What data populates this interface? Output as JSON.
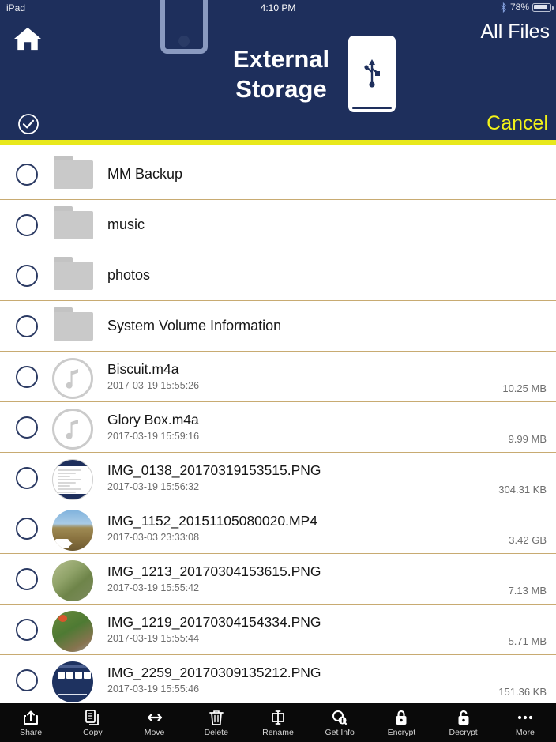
{
  "statusbar": {
    "device": "iPad",
    "time": "4:10 PM",
    "battery_percent": "78%",
    "bluetooth_icon": "bluetooth-icon",
    "battery_icon": "battery-icon"
  },
  "header": {
    "home_icon": "home-icon",
    "title_line1": "External",
    "title_line2": "Storage",
    "all_files_label": "All Files",
    "usb_icon": "usb-icon",
    "device_icon": "ipad-device-icon",
    "select_all_icon": "check-circle-icon",
    "cancel_label": "Cancel",
    "navy": "#1e2f5c",
    "yellow": "#e8e81c",
    "cancel_color": "#f2f218"
  },
  "files": [
    {
      "name": "MM Backup",
      "date": "",
      "size": "",
      "kind": "folder"
    },
    {
      "name": "music",
      "date": "",
      "size": "",
      "kind": "folder"
    },
    {
      "name": "photos",
      "date": "",
      "size": "",
      "kind": "folder"
    },
    {
      "name": "System Volume Information",
      "date": "",
      "size": "",
      "kind": "folder"
    },
    {
      "name": "Biscuit.m4a",
      "date": "2017-03-19 15:55:26",
      "size": "10.25 MB",
      "kind": "audio"
    },
    {
      "name": "Glory Box.m4a",
      "date": "2017-03-19 15:59:16",
      "size": "9.99 MB",
      "kind": "audio"
    },
    {
      "name": "IMG_0138_20170319153515.PNG",
      "date": "2017-03-19 15:56:32",
      "size": "304.31 KB",
      "kind": "photo-doc"
    },
    {
      "name": "IMG_1152_20151105080020.MP4",
      "date": "2017-03-03 23:33:08",
      "size": "3.42 GB",
      "kind": "video"
    },
    {
      "name": "IMG_1213_20170304153615.PNG",
      "date": "2017-03-19 15:55:42",
      "size": "7.13 MB",
      "kind": "photo-grass"
    },
    {
      "name": "IMG_1219_20170304154334.PNG",
      "date": "2017-03-19 15:55:44",
      "size": "5.71 MB",
      "kind": "photo-tomato"
    },
    {
      "name": "IMG_2259_20170309135212.PNG",
      "date": "2017-03-19 15:55:46",
      "size": "151.36 KB",
      "kind": "photo-screen"
    }
  ],
  "toolbar": [
    {
      "label": "Share",
      "icon": "share-icon"
    },
    {
      "label": "Copy",
      "icon": "copy-icon"
    },
    {
      "label": "Move",
      "icon": "move-arrows-icon"
    },
    {
      "label": "Delete",
      "icon": "trash-icon"
    },
    {
      "label": "Rename",
      "icon": "rename-icon"
    },
    {
      "label": "Get Info",
      "icon": "info-magnifier-icon"
    },
    {
      "label": "Encrypt",
      "icon": "lock-closed-icon"
    },
    {
      "label": "Decrypt",
      "icon": "lock-open-icon"
    },
    {
      "label": "More",
      "icon": "ellipsis-icon"
    }
  ]
}
